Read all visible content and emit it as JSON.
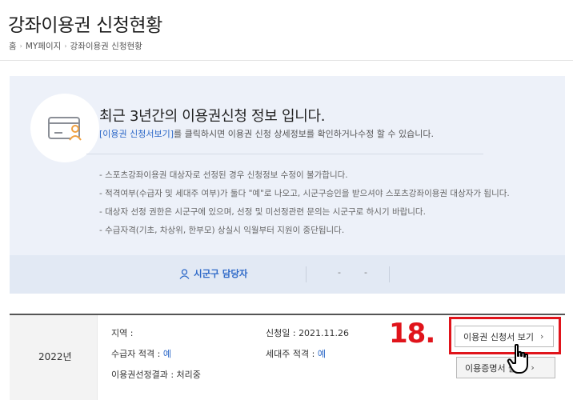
{
  "page": {
    "title": "강좌이용권 신청현황"
  },
  "breadcrumb": {
    "home": "홈",
    "mypage": "MY페이지",
    "current": "강좌이용권 신청현황",
    "separator": "›"
  },
  "info": {
    "heading": "최근 3년간의 이용권신청 정보 입니다.",
    "link_text": "[이용권 신청서보기]",
    "sub_text": "를 클릭하시면 이용권 신청 상세정보를 확인하거나수정 할 수 있습니다.",
    "notes": [
      "- 스포츠강좌이용권 대상자로 선정된 경우 신청정보 수정이 불가합니다.",
      "- 적격여부(수급자 및 세대주 여부)가 둘다 \"예\"로 나오고, 시군구승인을 받으셔야 스포츠강좌이용권 대상자가 됩니다.",
      "- 대상자 선정 권한은 시군구에 있으며, 선정 및 미선정관련 문의는 시군구로 하시기 바랍니다.",
      "- 수급자격(기초, 차상위, 한부모) 상실시 익월부터 지원이 중단됩니다."
    ]
  },
  "contact": {
    "label": "시군구 담당자",
    "dash_1": "-",
    "dash_2": "-"
  },
  "application": {
    "year": "2022년",
    "region_label": "지역 :",
    "region_value": "",
    "date_label": "신청일 :",
    "date_value": "2021.11.26",
    "recipient_label": "수급자 적격 :",
    "recipient_value": "예",
    "household_label": "세대주 적격 :",
    "household_value": "예",
    "result_label": "이용권선정결과 :",
    "result_value": "처리중"
  },
  "buttons": {
    "view_application": "이용권 신청서 보기",
    "certificate": "이용증명서 출력",
    "chevron": "›"
  },
  "annotation": {
    "step": "18.",
    "color": "#e0141b"
  },
  "colors": {
    "link_blue": "#2e69c8",
    "panel_bg": "#edf1f9"
  }
}
